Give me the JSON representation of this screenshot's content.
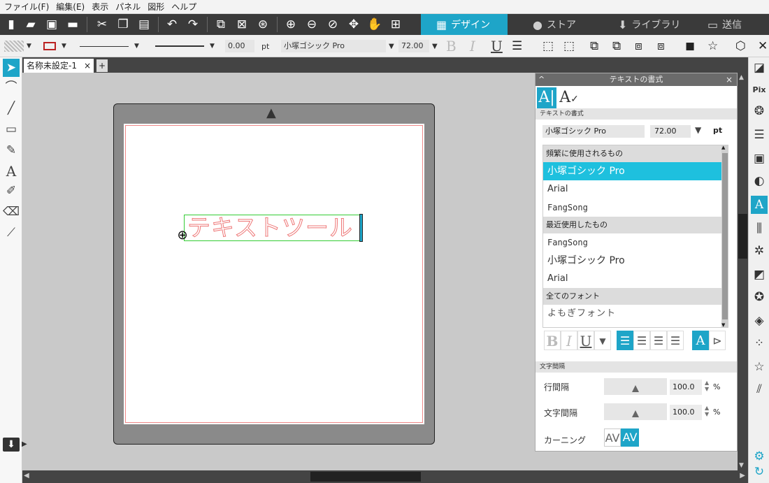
{
  "menu": [
    "ファイル(F)",
    "編集(E)",
    "表示",
    "パネル",
    "図形",
    "ヘルプ"
  ],
  "nav_tabs": {
    "design": "デザイン",
    "store": "ストア",
    "library": "ライブラリ",
    "send": "送信"
  },
  "line_style": {
    "width_value": "0.00",
    "width_unit": "pt"
  },
  "text_toolbar": {
    "font_name": "小塚ゴシック Pro",
    "font_size": "72.00",
    "bold": "B",
    "italic": "I",
    "underline": "U"
  },
  "document": {
    "tab_name": "名称未設定-1",
    "close": "×",
    "add": "+"
  },
  "canvas": {
    "text_object": "テキストツール"
  },
  "panel": {
    "title": "テキストの書式",
    "close": "×",
    "collapse": "^",
    "tab_a": "A|",
    "tab_b": "A",
    "section_title": "テキストの書式",
    "font_name": "小塚ゴシック Pro",
    "font_size": "72.00",
    "font_size_unit": "pt",
    "font_list": {
      "frequent_header": "頻繁に使用されるもの",
      "frequent": [
        "小塚ゴシック Pro",
        "Arial",
        "FangSong"
      ],
      "recent_header": "最近使用したもの",
      "recent": [
        "FangSong",
        "小塚ゴシック Pro",
        "Arial"
      ],
      "all_header": "全てのフォント",
      "all": [
        "よもぎフォント"
      ]
    },
    "format_buttons": {
      "bold": "B",
      "italic": "I",
      "underline": "U"
    },
    "spacing_section": "文字間隔",
    "line_spacing_label": "行間隔",
    "line_spacing_value": "100.0",
    "char_spacing_label": "文字間隔",
    "char_spacing_value": "100.0",
    "percent": "%",
    "kerning_label": "カーニング",
    "kerning_off": "AV",
    "kerning_on": "AV"
  },
  "colors": {
    "accent": "#1ea5c8",
    "toolbar_dark": "#3a3a3a",
    "text_outline": "#e77777",
    "selection_box": "#33cc33"
  }
}
